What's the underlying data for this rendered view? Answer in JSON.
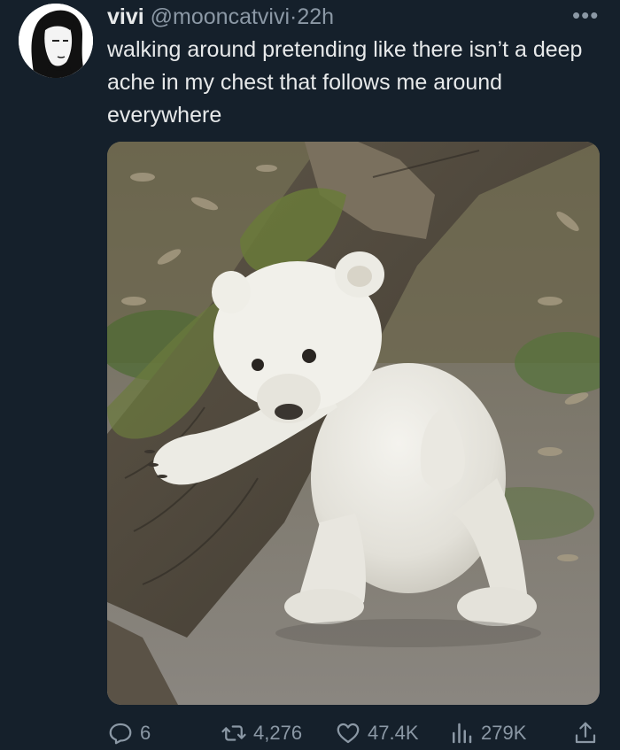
{
  "tweet": {
    "display_name": "vivi",
    "handle": "@mooncatvivi",
    "separator": "·",
    "time": "22h",
    "text": "walking around pretending like there isn’t a deep ache in my chest that follows me around everywhere",
    "media_alt": "polar bear cub walking beside a fallen log"
  },
  "actions": {
    "replies": "6",
    "retweets": "4,276",
    "likes": "47.4K",
    "views": "279K"
  },
  "icons": {
    "more": "more-horizontal-icon",
    "reply": "reply-icon",
    "retweet": "retweet-icon",
    "like": "heart-icon",
    "views": "views-icon",
    "share": "share-icon"
  },
  "colors": {
    "background": "#15202b",
    "text_primary": "#e7e9ea",
    "text_secondary": "#8b98a5"
  }
}
